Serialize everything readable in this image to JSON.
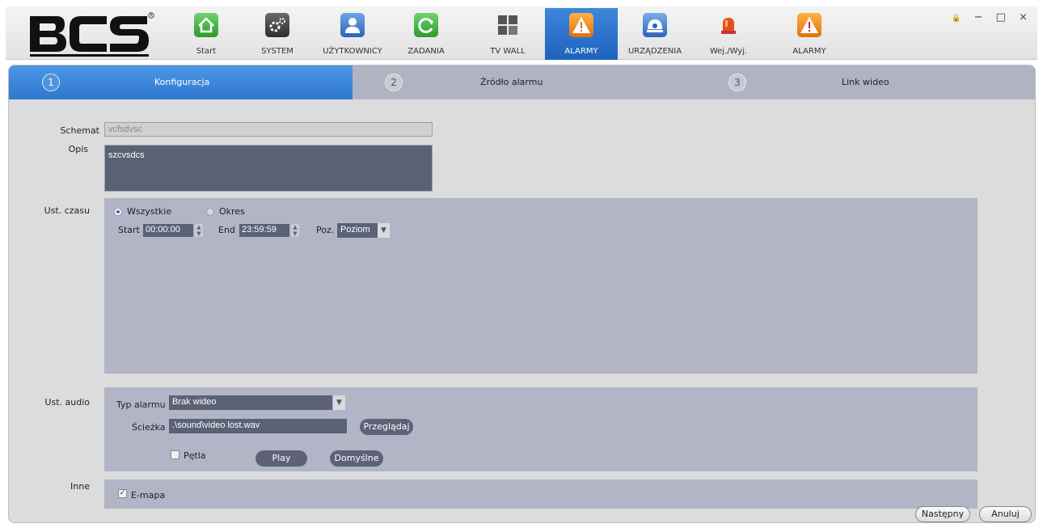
{
  "nav": {
    "items": [
      {
        "label": "Start",
        "icon": "home-icon",
        "color": "#3aa83a"
      },
      {
        "label": "SYSTEM",
        "icon": "gear-icon",
        "color": "#3a3a3a"
      },
      {
        "label": "UŻYTKOWNICY",
        "icon": "user-icon",
        "color": "#2f6bc2"
      },
      {
        "label": "ZADANIA",
        "icon": "refresh-icon",
        "color": "#3aa83a"
      },
      {
        "label": "TV WALL",
        "icon": "grid-icon",
        "color": "#4a4a4a"
      },
      {
        "label": "ALARMY",
        "icon": "alarm-settings-icon",
        "color": "#e07a10",
        "active": true
      },
      {
        "label": "URZĄDZENIA",
        "icon": "camera-icon",
        "color": "#3070c0"
      },
      {
        "label": "Wej./Wyj.",
        "icon": "siren-icon",
        "color": "#e04a10"
      },
      {
        "label": "ALARMY",
        "icon": "warning-icon",
        "color": "#e07a10"
      }
    ],
    "active_color": "#2b72cf"
  },
  "window": {
    "lock": "🔒",
    "minimize": "−",
    "maximize": "□",
    "close": "×"
  },
  "steps": [
    {
      "num": "1",
      "label": "Konfiguracja"
    },
    {
      "num": "2",
      "label": "Źródło alarmu"
    },
    {
      "num": "3",
      "label": "Link wideo"
    }
  ],
  "form": {
    "schemat_label": "Schemat",
    "schemat_value": "vcfsdvsc",
    "opis_label": "Opis",
    "opis_value": "szcvsdcs",
    "time_label": "Ust. czasu",
    "radio_all": "Wszystkie",
    "radio_period": "Okres",
    "start_label": "Start",
    "start_value": "00:00:00",
    "end_label": "End",
    "end_value": "23:59:59",
    "poz_label": "Poz.",
    "poz_value": "Poziom",
    "audio_label": "Ust. audio",
    "alarm_type_label": "Typ alarmu",
    "alarm_type_value": "Brak wideo",
    "path_label": "Ścieżka",
    "path_value": ".\\sound\\video lost.wav",
    "browse_label": "Przeglądaj",
    "loop_label": "Pętla",
    "play_label": "Play",
    "default_label": "Domyślne",
    "other_label": "Inne",
    "emap_label": "E-mapa"
  },
  "footer": {
    "next_label": "Następny",
    "cancel_label": "Anuluj"
  }
}
